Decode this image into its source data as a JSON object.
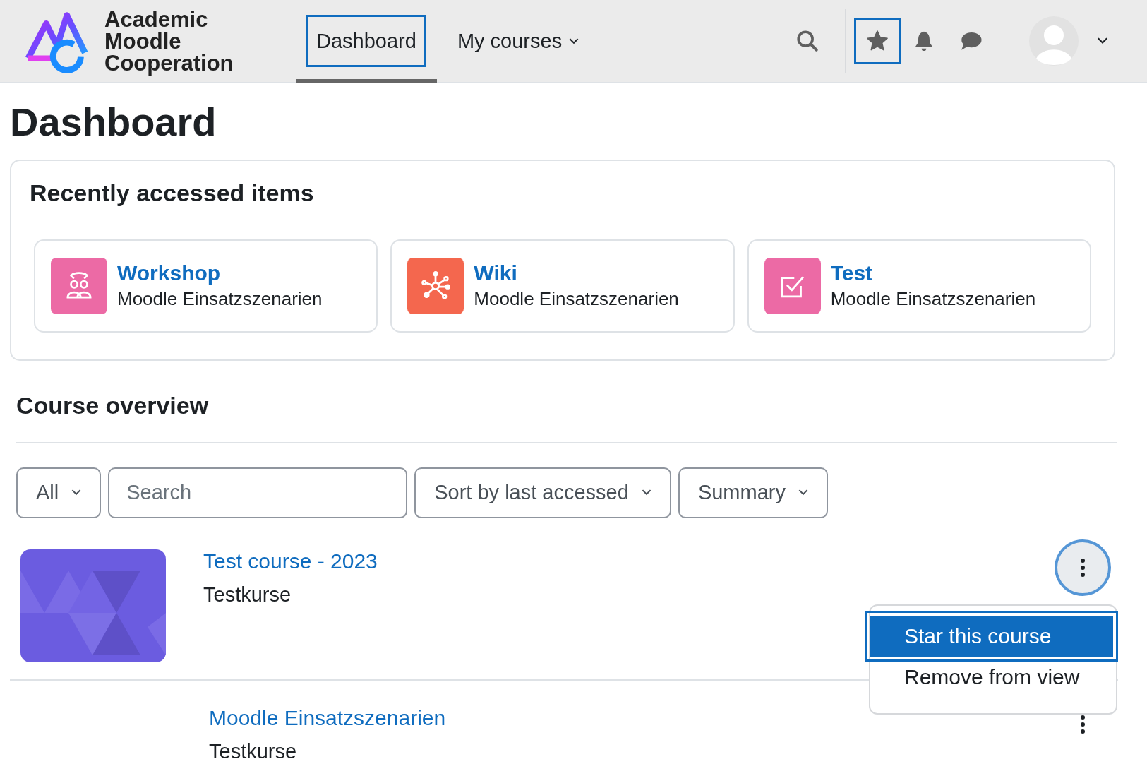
{
  "brand": {
    "lines": [
      "Academic",
      "Moodle",
      "Cooperation"
    ]
  },
  "nav": [
    {
      "label": "Dashboard",
      "selected": true,
      "dropdown": false
    },
    {
      "label": "My courses",
      "selected": false,
      "dropdown": true
    }
  ],
  "header_icons": [
    {
      "kind": "search",
      "focused": false
    },
    {
      "kind": "star",
      "focused": true
    },
    {
      "kind": "bell",
      "focused": false
    },
    {
      "kind": "chat",
      "focused": false
    }
  ],
  "page_title": "Dashboard",
  "recent": {
    "title": "Recently accessed items",
    "items": [
      {
        "kind": "workshop",
        "color": "#ec6aa5",
        "name": "Workshop",
        "course": "Moodle Einsatzszenarien"
      },
      {
        "kind": "wiki",
        "color": "#f4674e",
        "name": "Wiki",
        "course": "Moodle Einsatzszenarien"
      },
      {
        "kind": "test",
        "color": "#ec6aa5",
        "name": "Test",
        "course": "Moodle Einsatzszenarien"
      }
    ]
  },
  "overview": {
    "title": "Course overview",
    "filters": [
      {
        "kind": "select",
        "label": "All"
      },
      {
        "kind": "search",
        "placeholder": "Search"
      },
      {
        "kind": "select",
        "label": "Sort by last accessed"
      },
      {
        "kind": "select",
        "label": "Summary"
      }
    ],
    "courses": [
      {
        "name": "Test course - 2023",
        "category": "Testkurse",
        "has_image": true,
        "menu_open": true
      },
      {
        "name": "Moodle Einsatzszenarien",
        "category": "Testkurse",
        "has_image": false,
        "menu_open": false
      }
    ],
    "menu": [
      {
        "label": "Star this course",
        "selected": true
      },
      {
        "label": "Remove from view",
        "selected": false
      }
    ]
  }
}
